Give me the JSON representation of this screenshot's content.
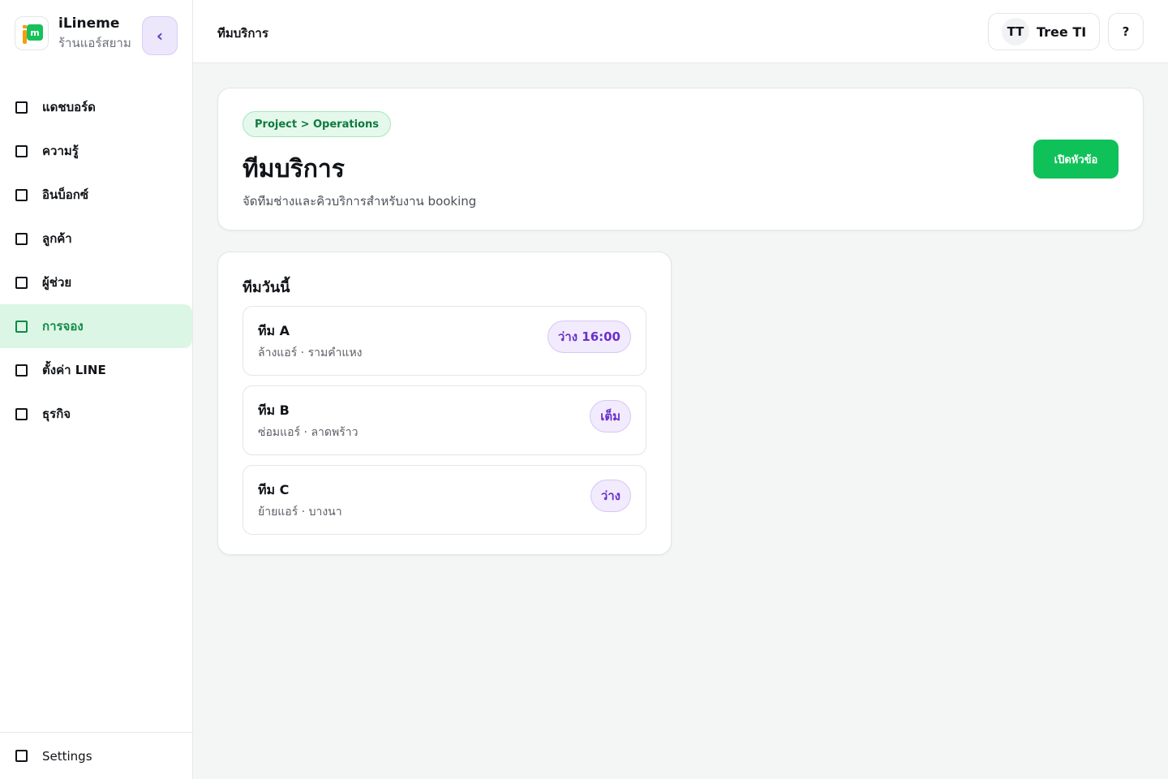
{
  "brand": {
    "logo_letter": "m",
    "name": "iLineme",
    "subtitle": "ร้านแอร์สยาม",
    "collapse_icon": "‹"
  },
  "nav": {
    "items": [
      {
        "label": "แดชบอร์ด",
        "active": false
      },
      {
        "label": "ความรู้",
        "active": false
      },
      {
        "label": "อินบ็อกซ์",
        "active": false
      },
      {
        "label": "ลูกค้า",
        "active": false
      },
      {
        "label": "ผู้ช่วย",
        "active": false
      },
      {
        "label": "การจอง",
        "active": true
      },
      {
        "label": "ตั้งค่า LINE",
        "active": false
      },
      {
        "label": "ธุรกิจ",
        "active": false
      }
    ],
    "footer_label": "Settings"
  },
  "topbar": {
    "title": "ทีมบริการ",
    "user_initials": "TT",
    "user_name": "Tree TI",
    "help_label": "?"
  },
  "header": {
    "breadcrumb": "Project > Operations",
    "title": "ทีมบริการ",
    "subtitle": "จัดทีมช่างและคิวบริการสำหรับงาน booking",
    "action_label": "เปิดหัวข้อ"
  },
  "teams": {
    "title": "ทีมวันนี้",
    "items": [
      {
        "name": "ทีม A",
        "desc": "ล้างแอร์ · รามคำแหง",
        "status": "ว่าง 16:00"
      },
      {
        "name": "ทีม B",
        "desc": "ซ่อมแอร์ · ลาดพร้าว",
        "status": "เต็ม"
      },
      {
        "name": "ทีม C",
        "desc": "ย้ายแอร์ · บางนา",
        "status": "ว่าง"
      }
    ]
  },
  "colors": {
    "accent_green": "#0fc159",
    "active_nav_bg": "#dcf6e5",
    "badge_purple": "#6a2fc9",
    "badge_bg": "#f1ebfd"
  }
}
